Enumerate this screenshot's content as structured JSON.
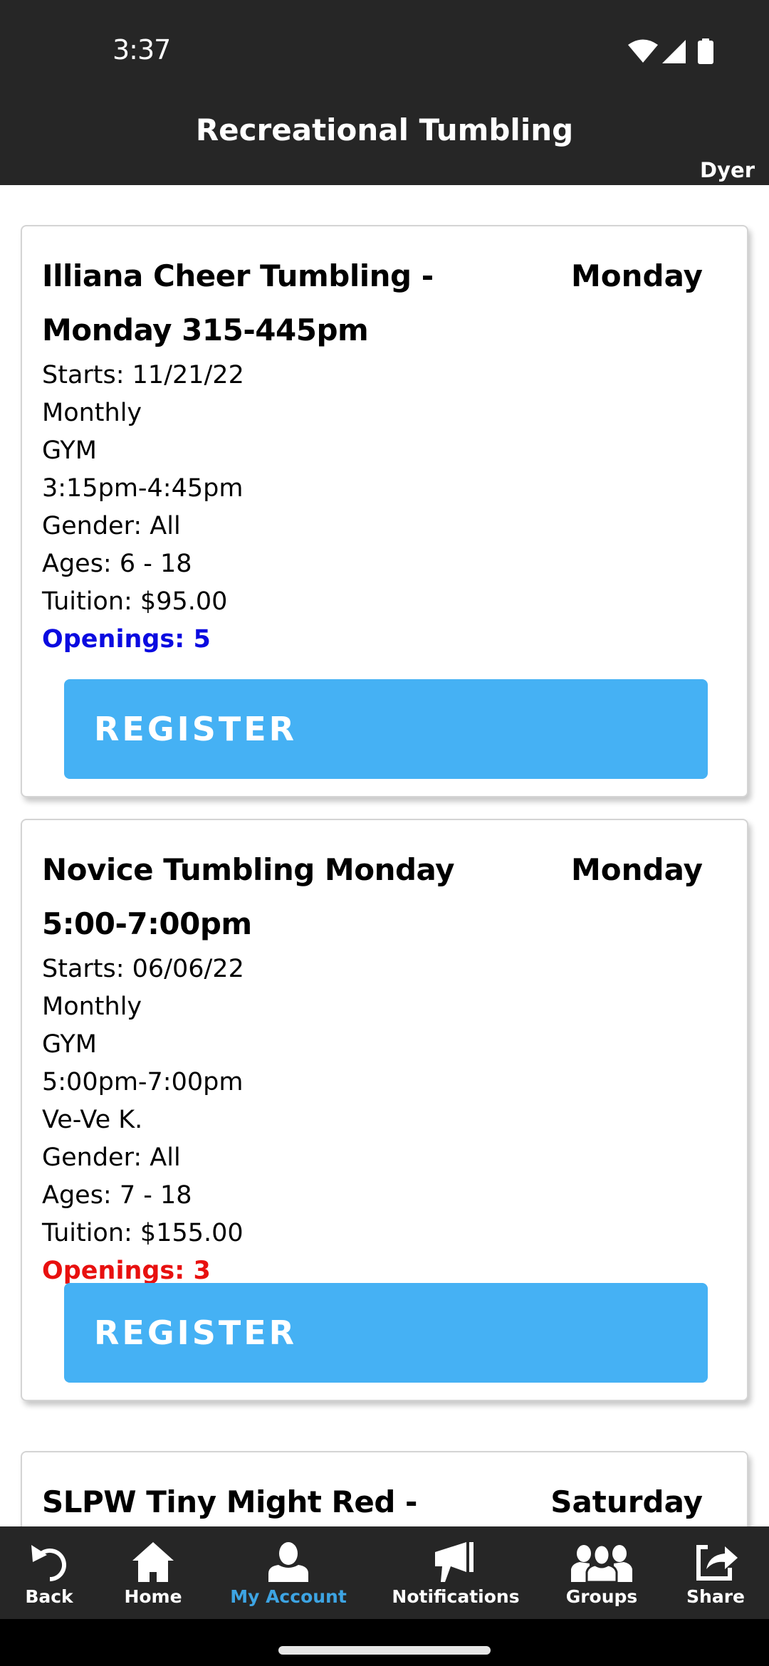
{
  "status_bar": {
    "time": "3:37",
    "icons": [
      "wifi-icon",
      "cellular-signal-icon",
      "battery-icon"
    ]
  },
  "header": {
    "title": "Recreational Tumbling",
    "location": "Dyer"
  },
  "classes": [
    {
      "title": "Illiana Cheer Tumbling - Monday 315-445pm",
      "day": "Monday",
      "details": [
        "Starts: 11/21/22",
        "Monthly",
        "GYM",
        "3:15pm-4:45pm",
        "Gender: All",
        "Ages: 6 - 18",
        "Tuition: $95.00"
      ],
      "openings": "Openings: 5",
      "openings_color": "#0a0ae0",
      "register_label": "REGISTER"
    },
    {
      "title": "Novice Tumbling Monday 5:00-7:00pm",
      "day": "Monday",
      "details": [
        "Starts: 06/06/22",
        "Monthly",
        "GYM",
        "5:00pm-7:00pm",
        "Ve-Ve K.",
        "Gender: All",
        "Ages: 7 - 18",
        "Tuition: $155.00"
      ],
      "openings": "Openings: 3",
      "openings_color": "#e8100f",
      "register_label": "REGISTER"
    },
    {
      "title": "SLPW Tiny Might Red -",
      "day": "Saturday"
    }
  ],
  "colors": {
    "bar_background": "#262626",
    "register_button": "#45b1f4",
    "active_nav": "#3da4e3"
  },
  "bottom_nav": {
    "items": [
      {
        "label": "Back",
        "icon": "back-arrow-icon",
        "active": false
      },
      {
        "label": "Home",
        "icon": "home-icon",
        "active": false
      },
      {
        "label": "My Account",
        "icon": "user-icon",
        "active": true
      },
      {
        "label": "Notifications",
        "icon": "megaphone-icon",
        "active": false
      },
      {
        "label": "Groups",
        "icon": "groups-icon",
        "active": false
      },
      {
        "label": "Share",
        "icon": "share-icon",
        "active": false
      }
    ]
  }
}
